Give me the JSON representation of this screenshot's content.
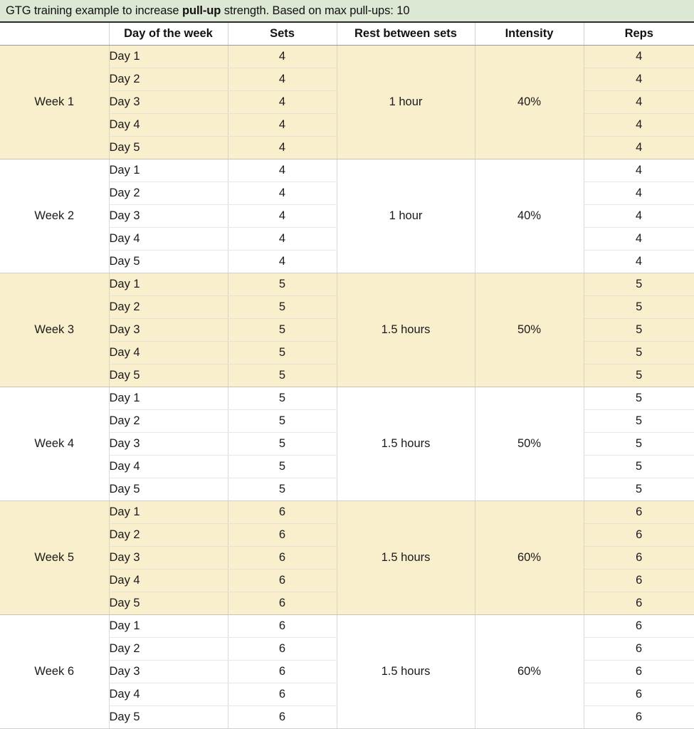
{
  "title": {
    "prefix": "GTG training example to increase ",
    "emphasis": "pull-up",
    "suffix": " strength. Based on max pull-ups: 10",
    "full": "GTG training example to increase pull-up strength. Based on max pull-ups: 10",
    "background_color": "#dce8d4"
  },
  "colors": {
    "highlight_row": "#faefcd",
    "plain_row": "#ffffff",
    "title_band": "#dce8d4",
    "text": "#111111",
    "grid_line": "#d9d5c6"
  },
  "table": {
    "columns": [
      {
        "key": "week",
        "label": ""
      },
      {
        "key": "day",
        "label": "Day of the week"
      },
      {
        "key": "sets",
        "label": "Sets"
      },
      {
        "key": "rest",
        "label": "Rest between sets"
      },
      {
        "key": "intensity",
        "label": "Intensity"
      },
      {
        "key": "reps",
        "label": "Reps"
      }
    ],
    "weeks": [
      {
        "week": "Week 1",
        "highlighted": true,
        "rest": "1 hour",
        "intensity": "40%",
        "days": [
          {
            "day": "Day 1",
            "sets": "4",
            "reps": "4"
          },
          {
            "day": "Day 2",
            "sets": "4",
            "reps": "4"
          },
          {
            "day": "Day 3",
            "sets": "4",
            "reps": "4"
          },
          {
            "day": "Day 4",
            "sets": "4",
            "reps": "4"
          },
          {
            "day": "Day 5",
            "sets": "4",
            "reps": "4"
          }
        ]
      },
      {
        "week": "Week 2",
        "highlighted": false,
        "rest": "1 hour",
        "intensity": "40%",
        "days": [
          {
            "day": "Day 1",
            "sets": "4",
            "reps": "4"
          },
          {
            "day": "Day 2",
            "sets": "4",
            "reps": "4"
          },
          {
            "day": "Day 3",
            "sets": "4",
            "reps": "4"
          },
          {
            "day": "Day 4",
            "sets": "4",
            "reps": "4"
          },
          {
            "day": "Day 5",
            "sets": "4",
            "reps": "4"
          }
        ]
      },
      {
        "week": "Week 3",
        "highlighted": true,
        "rest": "1.5 hours",
        "intensity": "50%",
        "days": [
          {
            "day": "Day 1",
            "sets": "5",
            "reps": "5"
          },
          {
            "day": "Day 2",
            "sets": "5",
            "reps": "5"
          },
          {
            "day": "Day 3",
            "sets": "5",
            "reps": "5"
          },
          {
            "day": "Day 4",
            "sets": "5",
            "reps": "5"
          },
          {
            "day": "Day 5",
            "sets": "5",
            "reps": "5"
          }
        ]
      },
      {
        "week": "Week 4",
        "highlighted": false,
        "rest": "1.5 hours",
        "intensity": "50%",
        "days": [
          {
            "day": "Day 1",
            "sets": "5",
            "reps": "5"
          },
          {
            "day": "Day 2",
            "sets": "5",
            "reps": "5"
          },
          {
            "day": "Day 3",
            "sets": "5",
            "reps": "5"
          },
          {
            "day": "Day 4",
            "sets": "5",
            "reps": "5"
          },
          {
            "day": "Day 5",
            "sets": "5",
            "reps": "5"
          }
        ]
      },
      {
        "week": "Week 5",
        "highlighted": true,
        "rest": "1.5 hours",
        "intensity": "60%",
        "days": [
          {
            "day": "Day 1",
            "sets": "6",
            "reps": "6"
          },
          {
            "day": "Day 2",
            "sets": "6",
            "reps": "6"
          },
          {
            "day": "Day 3",
            "sets": "6",
            "reps": "6"
          },
          {
            "day": "Day 4",
            "sets": "6",
            "reps": "6"
          },
          {
            "day": "Day 5",
            "sets": "6",
            "reps": "6"
          }
        ]
      },
      {
        "week": "Week 6",
        "highlighted": false,
        "rest": "1.5 hours",
        "intensity": "60%",
        "days": [
          {
            "day": "Day 1",
            "sets": "6",
            "reps": "6"
          },
          {
            "day": "Day 2",
            "sets": "6",
            "reps": "6"
          },
          {
            "day": "Day 3",
            "sets": "6",
            "reps": "6"
          },
          {
            "day": "Day 4",
            "sets": "6",
            "reps": "6"
          },
          {
            "day": "Day 5",
            "sets": "6",
            "reps": "6"
          }
        ]
      }
    ]
  }
}
